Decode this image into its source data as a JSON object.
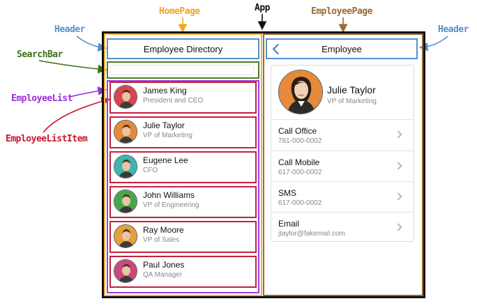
{
  "labels": {
    "app": "App",
    "home_page": "HomePage",
    "employee_page": "EmployeePage",
    "header_left": "Header",
    "header_right": "Header",
    "search_bar": "SearchBar",
    "employee_list": "EmployeeList",
    "employee_list_item": "EmployeeListItem"
  },
  "colors": {
    "app": "#111111",
    "home_page": "#f0a326",
    "employee_page": "#9b6a34",
    "header": "#5590cc",
    "search_bar": "#3e6f17",
    "employee_list": "#9a2fdc",
    "employee_list_item": "#c8162e",
    "back_chevron": "#3a78c8"
  },
  "home": {
    "title": "Employee Directory",
    "search_placeholder": "",
    "employees": [
      {
        "name": "James King",
        "title": "President and CEO",
        "avatar_bg": "#d8444f"
      },
      {
        "name": "Julie Taylor",
        "title": "VP of Marketing",
        "avatar_bg": "#e58a3a"
      },
      {
        "name": "Eugene Lee",
        "title": "CFO",
        "avatar_bg": "#3fb5b0"
      },
      {
        "name": "John Williams",
        "title": "VP of Engineering",
        "avatar_bg": "#47a84a"
      },
      {
        "name": "Ray Moore",
        "title": "VP of Sales",
        "avatar_bg": "#e4a03b"
      },
      {
        "name": "Paul Jones",
        "title": "QA Manager",
        "avatar_bg": "#c9497c"
      }
    ]
  },
  "detail": {
    "header_title": "Employee",
    "back_icon": "chevron-left-icon",
    "name": "Julie Taylor",
    "title": "VP of Marketing",
    "actions": [
      {
        "label": "Call Office",
        "value": "781-000-0002",
        "icon": "chevron-right-icon"
      },
      {
        "label": "Call Mobile",
        "value": "617-000-0002",
        "icon": "chevron-right-icon"
      },
      {
        "label": "SMS",
        "value": "617-000-0002",
        "icon": "chevron-right-icon"
      },
      {
        "label": "Email",
        "value": "jtaylor@fakemail.com",
        "icon": "chevron-right-icon"
      }
    ]
  }
}
